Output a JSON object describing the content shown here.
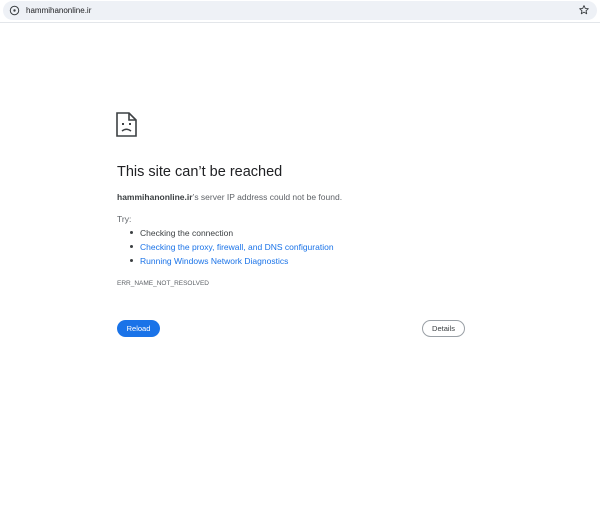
{
  "browser": {
    "url": "hammihanonline.ir",
    "icons": {
      "site_info": "info-circle-icon",
      "bookmark": "star-icon"
    }
  },
  "error": {
    "icon": "sad-file-icon",
    "title": "This site can’t be reached",
    "host": "hammihanonline.ir",
    "description_suffix": "’s server IP address could not be found.",
    "try_label": "Try:",
    "suggestions": [
      {
        "text": "Checking the connection",
        "is_link": false
      },
      {
        "text": "Checking the proxy, firewall, and DNS configuration",
        "is_link": true
      },
      {
        "text": "Running Windows Network Diagnostics",
        "is_link": true
      }
    ],
    "code": "ERR_NAME_NOT_RESOLVED"
  },
  "buttons": {
    "reload_label": "Reload",
    "details_label": "Details"
  },
  "colors": {
    "accent": "#1a73e8",
    "text": "#202124",
    "muted": "#5f6368",
    "omnibox_bg": "#eef1f6"
  }
}
